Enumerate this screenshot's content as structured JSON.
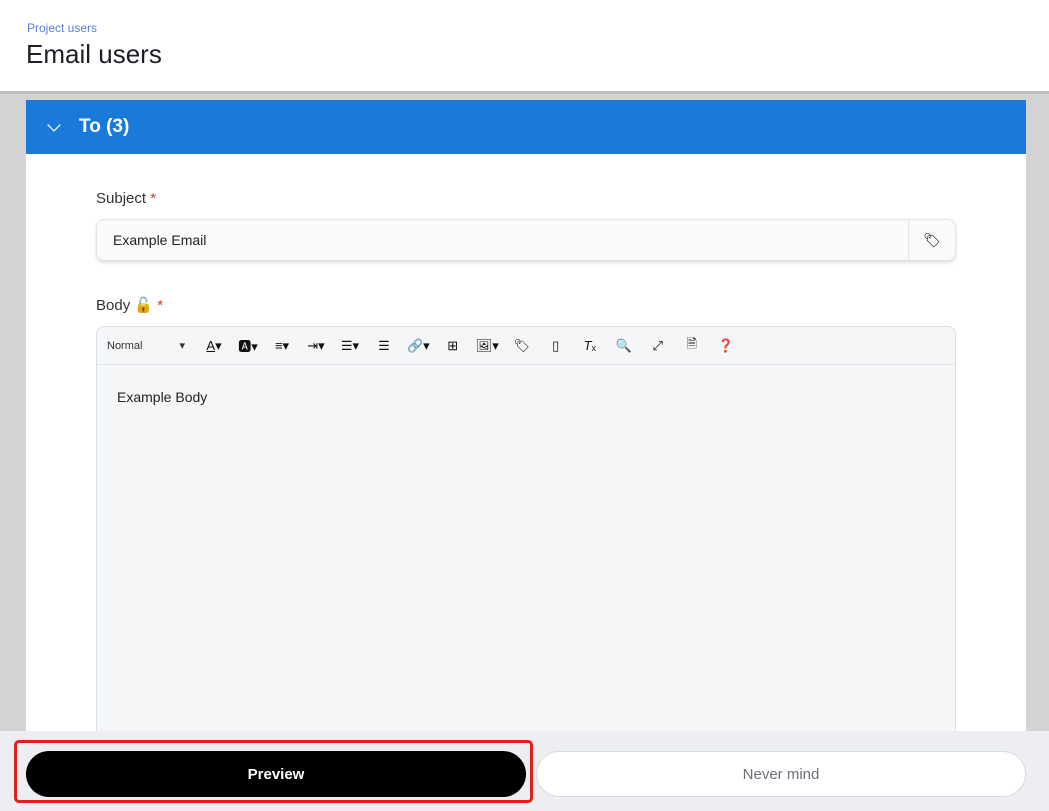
{
  "header": {
    "breadcrumb": "Project users",
    "title": "Email users"
  },
  "to_section": {
    "label": "To (3)"
  },
  "subject": {
    "label": "Subject",
    "required": "*",
    "value": "Example Email",
    "tag_icon": "tag-icon"
  },
  "body": {
    "label": "Body",
    "required": "*",
    "lock_icon": "unlock-icon",
    "format": "Normal",
    "content": "Example Body",
    "toolbar": [
      "font-color",
      "background-color",
      "align",
      "indent",
      "list",
      "horizontal-rule",
      "link",
      "table",
      "image",
      "tag",
      "field",
      "clear-format",
      "search",
      "fullscreen",
      "source",
      "help"
    ]
  },
  "footer": {
    "preview_label": "Preview",
    "cancel_label": "Never mind"
  },
  "colors": {
    "accent": "#1a7ad9",
    "highlight": "#e0201a"
  }
}
